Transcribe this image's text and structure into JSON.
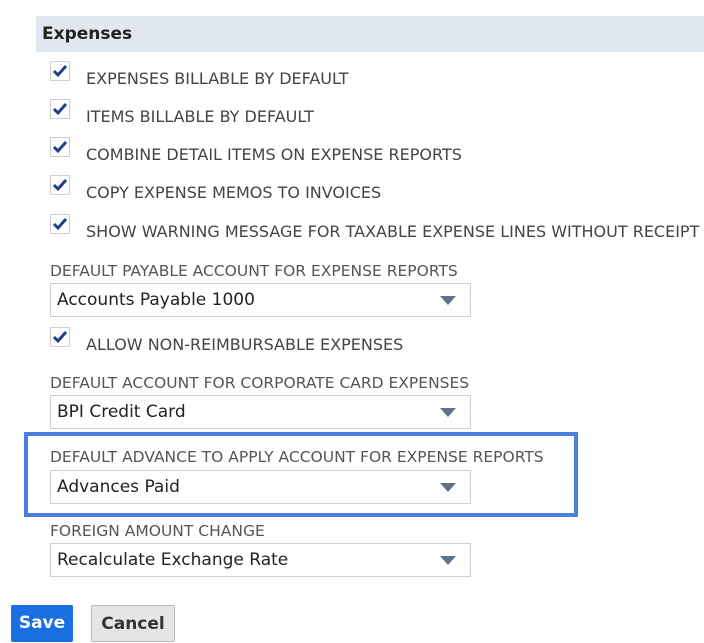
{
  "section": {
    "title": "Expenses"
  },
  "checkboxes": [
    {
      "label": "EXPENSES BILLABLE BY DEFAULT",
      "checked": true
    },
    {
      "label": "ITEMS BILLABLE BY DEFAULT",
      "checked": true
    },
    {
      "label": "COMBINE DETAIL ITEMS ON EXPENSE REPORTS",
      "checked": true
    },
    {
      "label": "COPY EXPENSE MEMOS TO INVOICES",
      "checked": true
    },
    {
      "label": "SHOW WARNING MESSAGE FOR TAXABLE EXPENSE LINES WITHOUT RECEIPT",
      "checked": true
    }
  ],
  "default_payable": {
    "label": "DEFAULT PAYABLE ACCOUNT FOR EXPENSE REPORTS",
    "value": "Accounts Payable 1000"
  },
  "non_reimbursable": {
    "label": "ALLOW NON-REIMBURSABLE EXPENSES",
    "checked": true
  },
  "corporate_card": {
    "label": "DEFAULT ACCOUNT FOR CORPORATE CARD EXPENSES",
    "value": "BPI Credit Card"
  },
  "advance_account": {
    "label": "DEFAULT ADVANCE TO APPLY ACCOUNT FOR EXPENSE REPORTS",
    "value": "Advances Paid"
  },
  "foreign_amount": {
    "label": "FOREIGN AMOUNT CHANGE",
    "value": "Recalculate Exchange Rate"
  },
  "buttons": {
    "save": "Save",
    "cancel": "Cancel"
  },
  "colors": {
    "header_bg": "#e1e7ee",
    "check": "#1f3f86",
    "highlight": "#4a7fe0",
    "save_bg": "#1a6fe0",
    "arrow": "#5f7287"
  }
}
